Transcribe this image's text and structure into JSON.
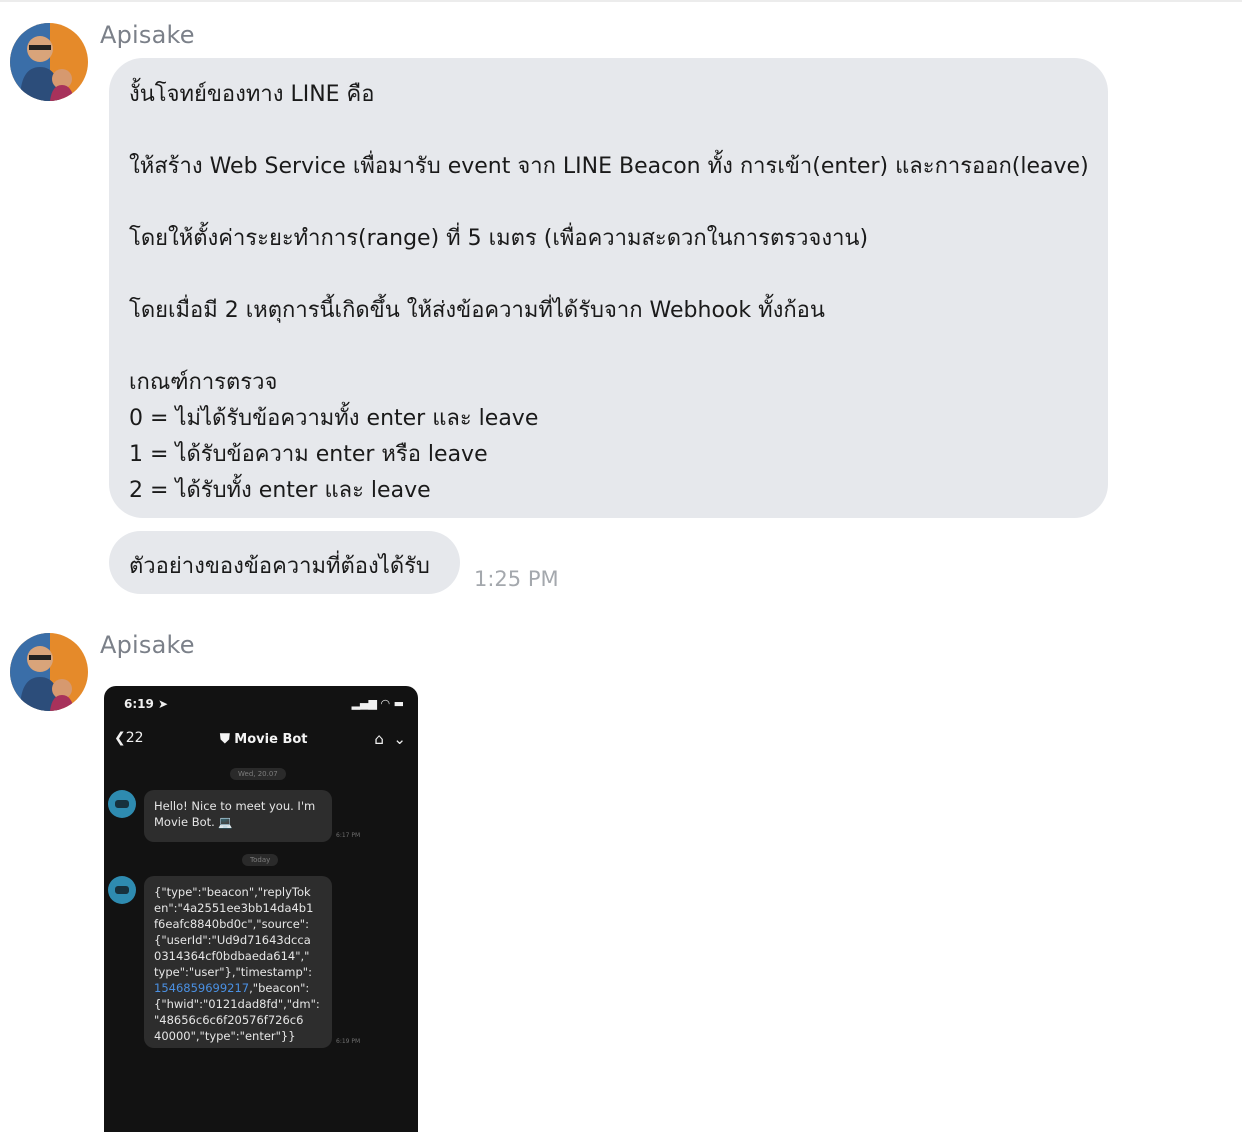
{
  "messages": [
    {
      "sender": "Apisake",
      "lines": [
        "งั้นโจทย์ของทาง LINE คือ",
        "ให้สร้าง Web Service เพื่อมารับ event จาก LINE Beacon ทั้ง การเข้า(enter) และการออก(leave)",
        "โดยให้ตั้งค่าระยะทำการ(range) ที่ 5 เมตร (เพื่อความสะดวกในการตรวจงาน)",
        "โดยเมื่อมี 2 เหตุการนี้เกิดขึ้น ให้ส่งข้อความที่ได้รับจาก Webhook ทั้งก้อน",
        "เกณฑ์การตรวจ",
        "0 = ไม่ได้รับข้อความทั้ง enter และ leave",
        "1 = ได้รับข้อความ enter หรือ leave",
        "2 = ได้รับทั้ง enter และ leave"
      ],
      "followup": "ตัวอย่างของข้อความที่ต้องได้รับ",
      "time": "1:25 PM"
    },
    {
      "sender": "Apisake",
      "attachment": {
        "status_time": "6:19",
        "back_count": "22",
        "chat_title": "Movie Bot",
        "date_chip_1": "Wed, 20.07",
        "date_chip_2": "Today",
        "greeting_line_1": "Hello! Nice to meet you. I'm",
        "greeting_line_2": "Movie Bot. 💻",
        "greeting_time": "6:17 PM",
        "payload_lines": [
          "{\"type\":\"beacon\",\"replyTok",
          "en\":\"4a2551ee3bb14da4b1",
          "f6eafc8840bd0c\",\"source\":",
          "{\"userId\":\"Ud9d71643dcca",
          "0314364cf0bdbaeda614\",\"",
          "type\":\"user\"},\"timestamp\":"
        ],
        "payload_link": "1546859699217",
        "payload_link_tail": ",\"beacon\":",
        "payload_lines_2": [
          "{\"hwid\":\"0121dad8fd\",\"dm\":",
          "\"48656c6c6f20576f726c6",
          "40000\",\"type\":\"enter\"}}"
        ],
        "payload_time": "6:19 PM"
      }
    }
  ],
  "icons": {
    "back": "chevron-left-icon",
    "shield": "shield-icon",
    "home": "home-icon",
    "dropdown": "chevron-down-icon",
    "signal": "signal-icon",
    "wifi": "wifi-icon",
    "battery": "battery-icon"
  },
  "colors": {
    "bubble": "#e6e8ec",
    "sender": "#7b8089",
    "time": "#a4a8ad",
    "avatar_bg": "#e58a2a",
    "phone_bg": "#121212",
    "link": "#4a90e2"
  }
}
